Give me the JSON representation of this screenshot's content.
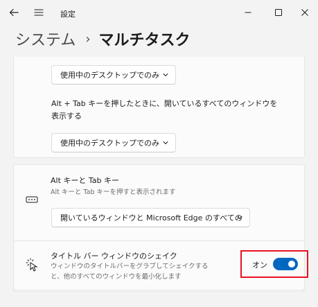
{
  "titlebar": {
    "app_title": "設定"
  },
  "header": {
    "breadcrumb_parent": "システム",
    "breadcrumb_separator": "›",
    "breadcrumb_current": "マルチタスク"
  },
  "sections": {
    "desktop_dropdown_1": "使用中のデスクトップでのみ",
    "alt_tab_windows_text": "Alt + Tab キーを押したときに、開いているすべてのウィンドウを表示する",
    "desktop_dropdown_2": "使用中のデスクトップでのみ",
    "alt_tab": {
      "title": "Alt キーと Tab キー",
      "subtitle": "Alt キーと Tab キーを押すと表示されます",
      "dropdown_value": "開いているウィンドウと Microsoft Edge のすべての"
    },
    "title_bar_shake": {
      "title": "タイトル バー ウィンドウのシェイク",
      "description": "ウィンドウのタイトルバーをグラブしてシェイクすると、他のすべてのウィンドウを最小化します",
      "toggle_label": "オン",
      "toggle_on": true
    }
  },
  "colors": {
    "accent": "#0067c0",
    "highlight_border": "#e81123",
    "background": "#f3f3f3",
    "card": "#fbfbfb"
  },
  "icons": {
    "back": "back-arrow-icon",
    "menu": "hamburger-menu-icon",
    "minimize": "minimize-icon",
    "maximize": "maximize-icon",
    "close": "close-icon",
    "dropdown": "chevron-down-icon",
    "alt_tab": "keyboard-icon",
    "shake": "shake-cursor-icon"
  }
}
